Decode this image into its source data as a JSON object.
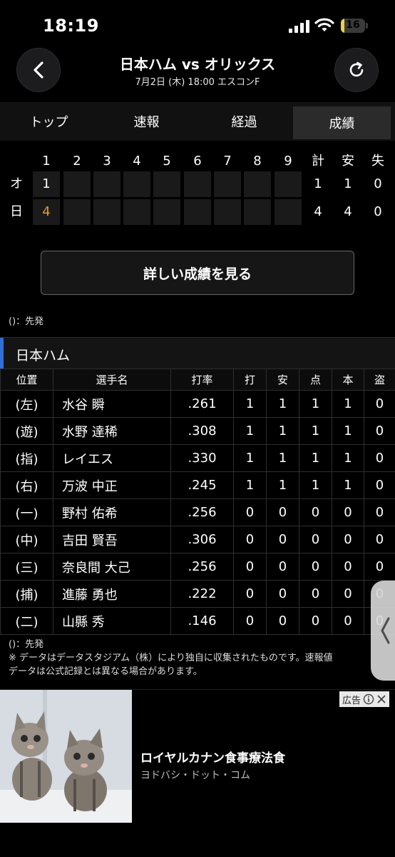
{
  "status_bar": {
    "time": "18:19",
    "battery": "16",
    "battery_level": 0.16
  },
  "header": {
    "title": "日本ハム vs オリックス",
    "subtitle": "7月2日 (木) 18:00 エスコンF"
  },
  "tabs": [
    {
      "label": "トップ",
      "active": false
    },
    {
      "label": "速報",
      "active": false
    },
    {
      "label": "経過",
      "active": false
    },
    {
      "label": "成績",
      "active": true
    }
  ],
  "line_score": {
    "columns": [
      "1",
      "2",
      "3",
      "4",
      "5",
      "6",
      "7",
      "8",
      "9",
      "計",
      "安",
      "失"
    ],
    "rows": [
      {
        "team": "オ",
        "innings": [
          "1",
          "",
          "",
          "",
          "",
          "",
          "",
          "",
          ""
        ],
        "totals": [
          "1",
          "1",
          "0"
        ]
      },
      {
        "team": "日",
        "innings": [
          "4",
          "",
          "",
          "",
          "",
          "",
          "",
          "",
          ""
        ],
        "totals": [
          "4",
          "4",
          "0"
        ]
      }
    ]
  },
  "detail_button": "詳しい成績を見る",
  "note_top": "()：先発",
  "team": {
    "name": "日本ハム",
    "headers": [
      "位置",
      "選手名",
      "打率",
      "打",
      "安",
      "点",
      "本",
      "盗"
    ],
    "players": [
      [
        "(左)",
        "水谷 瞬",
        ".261",
        "1",
        "1",
        "1",
        "1",
        "0"
      ],
      [
        "(遊)",
        "水野 達稀",
        ".308",
        "1",
        "1",
        "1",
        "1",
        "0"
      ],
      [
        "(指)",
        "レイエス",
        ".330",
        "1",
        "1",
        "1",
        "1",
        "0"
      ],
      [
        "(右)",
        "万波 中正",
        ".245",
        "1",
        "1",
        "1",
        "1",
        "0"
      ],
      [
        "(一)",
        "野村 佑希",
        ".256",
        "0",
        "0",
        "0",
        "0",
        "0"
      ],
      [
        "(中)",
        "吉田 賢吾",
        ".306",
        "0",
        "0",
        "0",
        "0",
        "0"
      ],
      [
        "(三)",
        "奈良間 大己",
        ".256",
        "0",
        "0",
        "0",
        "0",
        "0"
      ],
      [
        "(捕)",
        "進藤 勇也",
        ".222",
        "0",
        "0",
        "0",
        "0",
        "0"
      ],
      [
        "(二)",
        "山縣 秀",
        ".146",
        "0",
        "0",
        "0",
        "0",
        "0"
      ]
    ]
  },
  "note_bottom": [
    "()：先発",
    "※ データはデータスタジアム（株）により独自に収集されたものです。速報値",
    "データは公式記録とは異なる場合があります。"
  ],
  "ad": {
    "label": "広告",
    "title": "ロイヤルカナン食事療法食",
    "subtitle": "ヨドバシ・ドット・コム"
  },
  "colors": {
    "accent_orange": "#f0962a",
    "team_bar": "#2f6fd6",
    "battery": "#e8d24a"
  }
}
